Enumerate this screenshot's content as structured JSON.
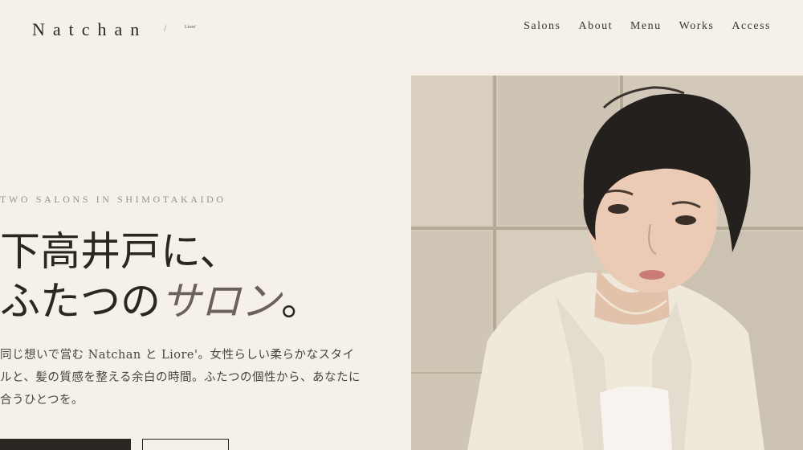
{
  "header": {
    "logo": "Natchan",
    "logo_separator": "/",
    "logo_sub": "Liore'",
    "nav": [
      "Salons",
      "About",
      "Menu",
      "Works",
      "Access"
    ]
  },
  "hero": {
    "eyebrow": "TWO SALONS IN SHIMOTAKAIDO",
    "headline_line1": "下高井戸に、",
    "headline_line2_plain": "ふたつの",
    "headline_line2_accent": "サロン",
    "headline_line2_end": "。",
    "description": "同じ想いで営む Natchan と Liore'。女性らしい柔らかなスタイルと、髪の質感を整える余白の時間。ふたつの個性から、あなたに合うひとつを。"
  },
  "colors": {
    "background": "#f5f0e8",
    "text": "#2a2622",
    "accent": "#6b6158",
    "button_dark": "#2a2622"
  }
}
